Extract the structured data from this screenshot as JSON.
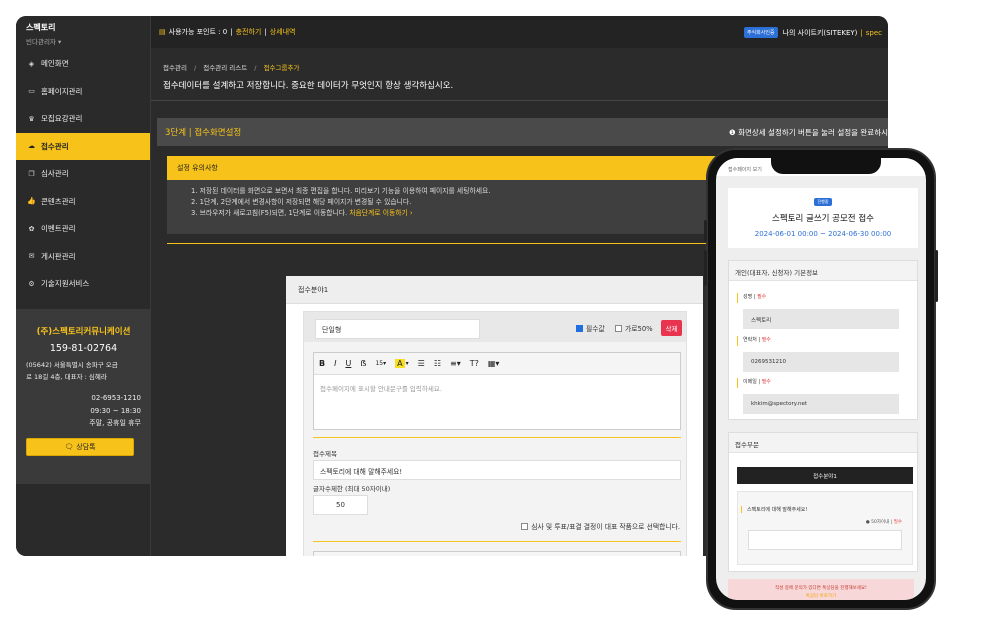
{
  "app": {
    "brand": "스펙토리",
    "brand_sub": "빈다관리자 ▾",
    "colors": {
      "accent": "#f7c31a",
      "dark": "#2a2a2a",
      "blue": "#2c6fd6",
      "red": "#e8344e"
    }
  },
  "sidebar": {
    "items": [
      {
        "label": "메인화면",
        "icon": "cube-icon"
      },
      {
        "label": "홈페이지관리",
        "icon": "monitor-icon"
      },
      {
        "label": "모집요강관리",
        "icon": "trophy-icon"
      },
      {
        "label": "접수관리",
        "icon": "cloud-upload-icon",
        "active": true
      },
      {
        "label": "심사관리",
        "icon": "copy-icon"
      },
      {
        "label": "콘텐츠관리",
        "icon": "thumbs-up-icon"
      },
      {
        "label": "이벤트관리",
        "icon": "gift-icon"
      },
      {
        "label": "게시판관리",
        "icon": "chat-icon"
      },
      {
        "label": "기술지원서비스",
        "icon": "gear-icon"
      }
    ],
    "company": {
      "name": "(주)스펙토리커뮤니케이션",
      "biz_no": "159-81-02764",
      "address_1": "(05642) 서울특별시 송파구 오금",
      "address_2": "로 18길 4층, 대표자 : 심혜라",
      "phone": "02-6953-1210",
      "hours": "09:30 ~ 18:30",
      "holiday": "주말, 공휴일 휴무",
      "consult_button": "상담톡"
    }
  },
  "topbar": {
    "points_label": "사용가능 포인트 : 0",
    "charge_link": "충전하기",
    "separator": "|",
    "detail_link": "상세내역",
    "badge": "주식회사인증",
    "site_name": "나의 사이트키(SITEKEY)",
    "site_suffix": "spec"
  },
  "page": {
    "breadcrumb": [
      "접수관리",
      "접수관리 리스트",
      "접수그룹추가"
    ],
    "breadcrumb_sep": "/",
    "description": "접수데이터를 설계하고 저장합니다. 중요한 데이터가 무엇인지 항상 생각하십시오.",
    "step_title": "3단계 | 접수화면설정",
    "step_info": "화면상세 설정하기 버튼을 눌러 설정을 완료하시"
  },
  "notice": {
    "title": "설정 유의사항",
    "lines": [
      "1. 저장된 데이터를 화면으로 보면서 최종 편집을 합니다. 미리보기 기능을 이용하여 페이지를 세팅하세요.",
      "2. 1단계, 2단계에서 변경사항이 저장되면 해당 페이지가 변경될 수 있습니다.",
      "3. 브라우저가 새로고침(F5)되면, 1단계로 이동합니다."
    ],
    "link": "처음단계로 이동하기 ›"
  },
  "form": {
    "section_title": "접수분야1",
    "name_value": "단일형",
    "required_label": "필수값",
    "width50_label": "가로50%",
    "delete_label": "삭제",
    "toolbar": [
      "B",
      "I",
      "U",
      "ẞ",
      "15▾",
      "A",
      "▾",
      "☰",
      "☷",
      "≡▾",
      "T?",
      "▦▾"
    ],
    "editor_placeholder": "접수페이지에 표시할 안내문구를 입력하세요.",
    "question_label": "접수제목",
    "question_value": "스펙토리에 대해 말해주세요!",
    "charlimit_label": "글자수제한 (최대 50자이내)",
    "charlimit_value": "50",
    "representative_label": "심사 및 투표/표결 결정이 대표 작품으로 선택합니다."
  },
  "phone": {
    "top_label": "접수페이지 보기",
    "badge": "진행중",
    "title": "스펙토리 글쓰기 공모전 접수",
    "date": "2024-06-01 00:00 ~ 2024-06-30 00:00",
    "personal_title": "개인(대표자, 신청자) 기본정보",
    "fields": [
      {
        "label": "성명",
        "req": "필수",
        "value": "스펙토리"
      },
      {
        "label": "연락처",
        "req": "필수",
        "value": "0269531210"
      },
      {
        "label": "이메일",
        "req": "필수",
        "value": "khkim@spectory.net"
      }
    ],
    "category_title": "접수부문",
    "category_tab": "접수분야1",
    "q_text": "스펙토리에 대해 말해주세요!",
    "q_limit": "50자이내",
    "q_req": "필수",
    "bottom_line1": "작성 중에 문의가 있다면 톡상담을 진행해보세요!",
    "bottom_line2": "톡상담 바로가기"
  }
}
